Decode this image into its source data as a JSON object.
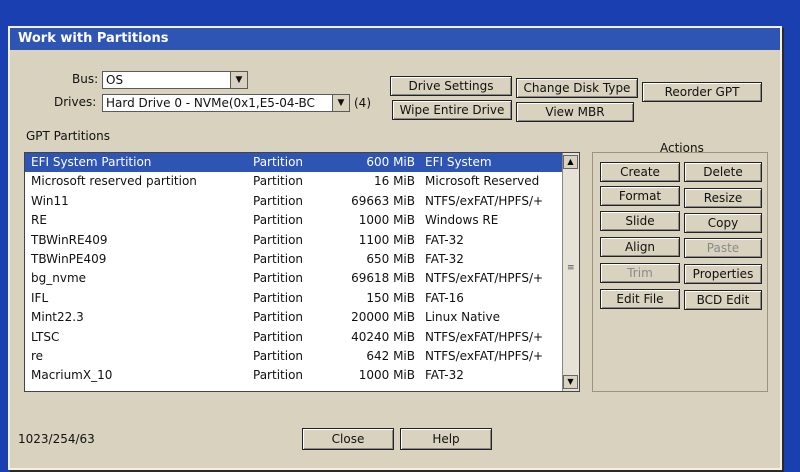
{
  "window": {
    "title": "Work with Partitions"
  },
  "bus": {
    "label": "Bus:",
    "value": "OS"
  },
  "drives": {
    "label": "Drives:",
    "value": "Hard Drive 0 - NVMe(0x1,E5-04-BC",
    "count": "(4)"
  },
  "top_buttons": {
    "drive_settings": "Drive Settings",
    "change_disk_type": "Change Disk Type",
    "reorder_gpt": "Reorder GPT",
    "wipe_entire_drive": "Wipe Entire Drive",
    "view_mbr": "View MBR"
  },
  "partitions_group": {
    "label": "GPT Partitions"
  },
  "partitions": [
    {
      "name": "EFI System Partition",
      "type": "Partition",
      "size": "600 MiB",
      "fs": "EFI System",
      "selected": true
    },
    {
      "name": "Microsoft reserved partition",
      "type": "Partition",
      "size": "16 MiB",
      "fs": "Microsoft Reserved"
    },
    {
      "name": "Win11",
      "type": "Partition",
      "size": "69663 MiB",
      "fs": "NTFS/exFAT/HPFS/+"
    },
    {
      "name": "RE",
      "type": "Partition",
      "size": "1000 MiB",
      "fs": "Windows RE"
    },
    {
      "name": "TBWinRE409",
      "type": "Partition",
      "size": "1100 MiB",
      "fs": "FAT-32"
    },
    {
      "name": "TBWinPE409",
      "type": "Partition",
      "size": "650 MiB",
      "fs": "FAT-32"
    },
    {
      "name": "bg_nvme",
      "type": "Partition",
      "size": "69618 MiB",
      "fs": "NTFS/exFAT/HPFS/+"
    },
    {
      "name": "IFL",
      "type": "Partition",
      "size": "150 MiB",
      "fs": "FAT-16"
    },
    {
      "name": "Mint22.3",
      "type": "Partition",
      "size": "20000 MiB",
      "fs": "Linux Native"
    },
    {
      "name": "LTSC",
      "type": "Partition",
      "size": "40240 MiB",
      "fs": "NTFS/exFAT/HPFS/+"
    },
    {
      "name": "re",
      "type": "Partition",
      "size": "642 MiB",
      "fs": "NTFS/exFAT/HPFS/+"
    },
    {
      "name": "MacriumX_10",
      "type": "Partition",
      "size": "1000 MiB",
      "fs": "FAT-32"
    }
  ],
  "actions": {
    "label": "Actions",
    "create": "Create",
    "delete": "Delete",
    "format": "Format",
    "resize": "Resize",
    "slide": "Slide",
    "copy": "Copy",
    "align": "Align",
    "paste": "Paste",
    "trim": "Trim",
    "properties": "Properties",
    "edit_file": "Edit File",
    "bcd_edit": "BCD Edit"
  },
  "status": {
    "geometry": "1023/254/63"
  },
  "footer": {
    "close": "Close",
    "help": "Help"
  },
  "icons": {
    "dropdown": "chevron-down-icon",
    "scroll_up": "arrow-up-icon",
    "scroll_down": "arrow-down-icon"
  },
  "colors": {
    "selection": "#2f55b4",
    "titlebar": "#2f55b4",
    "dialog_bg": "#d8d2be",
    "desktop": "#1a3fb0"
  }
}
